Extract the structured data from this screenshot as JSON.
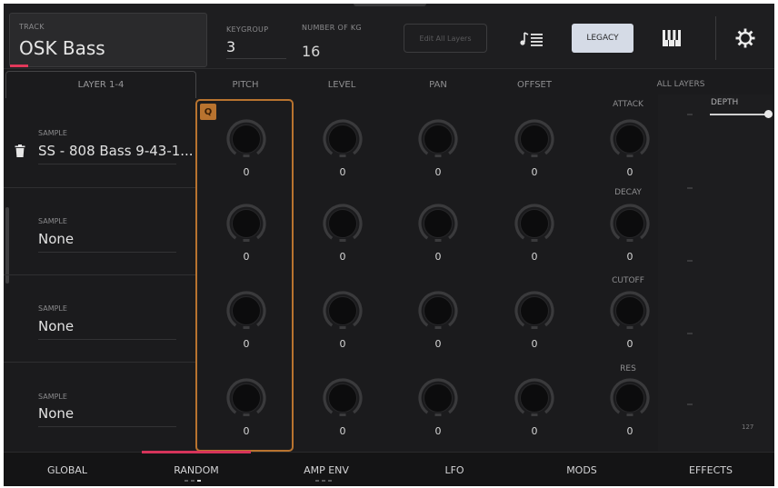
{
  "header": {
    "track_label": "TRACK",
    "track_name": "OSK Bass",
    "keygroup_label": "KEYGROUP",
    "keygroup_value": "3",
    "numkg_label": "NUMBER OF KG",
    "numkg_value": "16",
    "edit_layers_label": "Edit All Layers",
    "legacy_label": "LEGACY",
    "note_list_icon": "note-list-icon",
    "piano_icon": "piano-keys-icon",
    "gear_icon": "gear-icon"
  },
  "columns": {
    "layer_tab": "LAYER 1-4",
    "pitch": "PITCH",
    "level": "LEVEL",
    "pan": "PAN",
    "offset": "OFFSET",
    "all_layers": "ALL LAYERS"
  },
  "pitch_badge": "Q",
  "rows": [
    {
      "sample_label": "SAMPLE",
      "sample_name": "SS - 808 Bass 9-43-1...",
      "pitch": "0",
      "level": "0",
      "pan": "0",
      "offset": "0"
    },
    {
      "sample_label": "SAMPLE",
      "sample_name": "None",
      "pitch": "0",
      "level": "0",
      "pan": "0",
      "offset": "0"
    },
    {
      "sample_label": "SAMPLE",
      "sample_name": "None",
      "pitch": "0",
      "level": "0",
      "pan": "0",
      "offset": "0"
    },
    {
      "sample_label": "SAMPLE",
      "sample_name": "None",
      "pitch": "0",
      "level": "0",
      "pan": "0",
      "offset": "0"
    }
  ],
  "all_layers": {
    "attack_label": "ATTACK",
    "attack_value": "0",
    "decay_label": "DECAY",
    "decay_value": "0",
    "cutoff_label": "CUTOFF",
    "cutoff_value": "0",
    "res_label": "RES",
    "res_value": "0",
    "depth_label": "DEPTH",
    "depth_level": 1.0,
    "count_label": "127"
  },
  "bottom_nav": [
    {
      "label": "GLOBAL"
    },
    {
      "label": "RANDOM"
    },
    {
      "label": "AMP ENV"
    },
    {
      "label": "LFO"
    },
    {
      "label": "MODS"
    },
    {
      "label": "EFFECTS"
    }
  ],
  "colors": {
    "accent_pink": "#d6345a",
    "pitch_highlight": "#b8732f",
    "legacy_button": "#d5dbe6"
  }
}
